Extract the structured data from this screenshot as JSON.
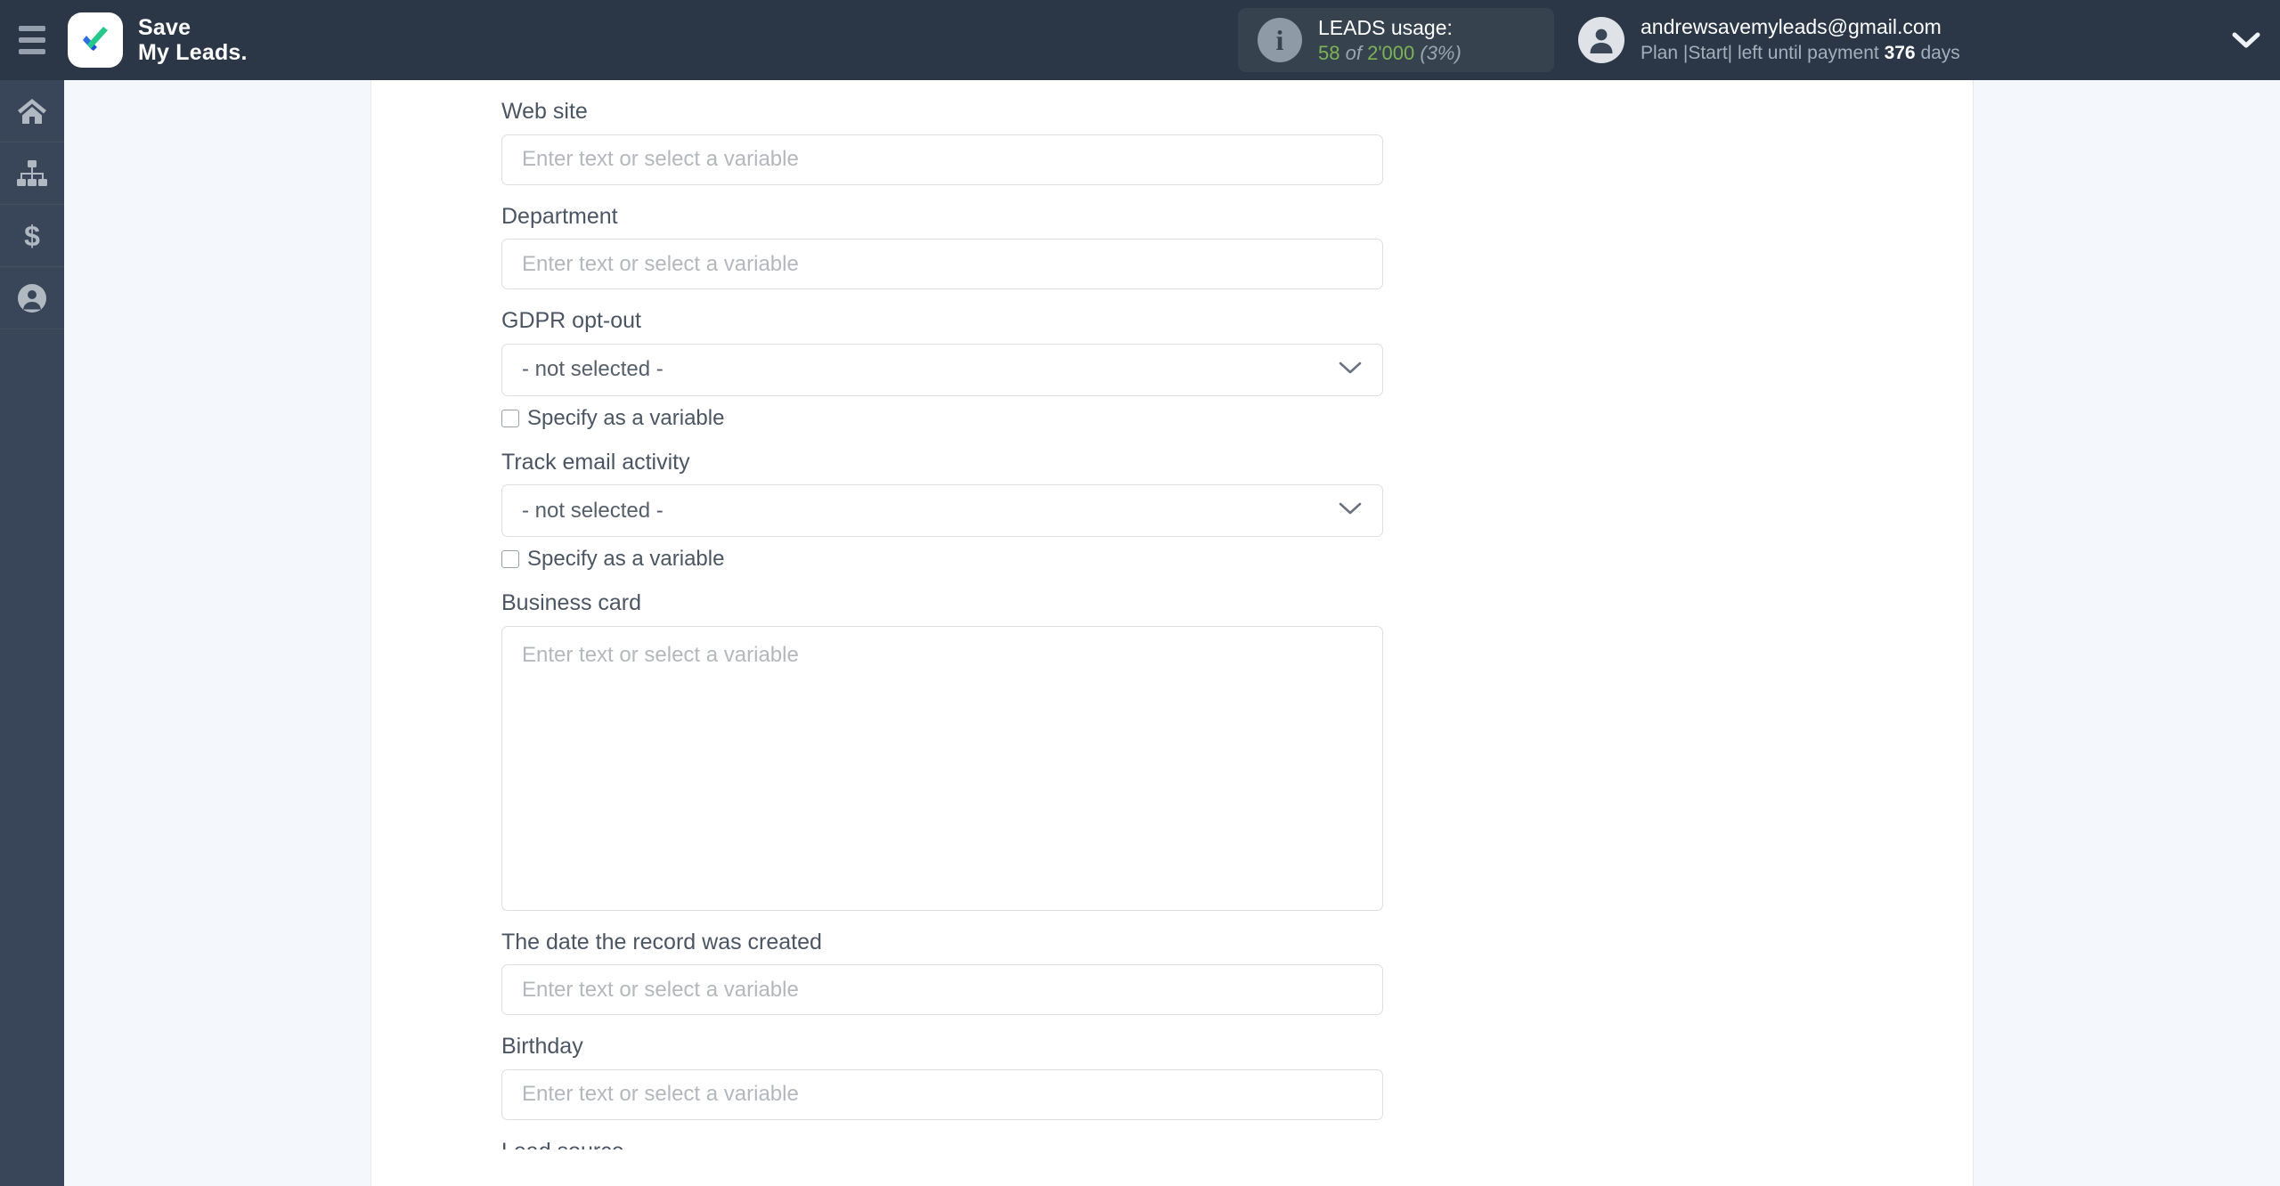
{
  "header": {
    "menu_icon": "hamburger-icon",
    "brand_line1": "Save",
    "brand_line2": "My Leads.",
    "usage": {
      "info_icon": "info-icon",
      "title": "LEADS usage:",
      "used": "58",
      "of": "of",
      "total": "2'000",
      "percent": "(3%)"
    },
    "account": {
      "avatar_icon": "user-avatar-icon",
      "email": "andrewsavemyleads@gmail.com",
      "plan_prefix": "Plan |Start| left until payment",
      "days_value": "376",
      "days_suffix": "days",
      "caret_icon": "chevron-down-icon"
    }
  },
  "sidebar": {
    "items": [
      {
        "name": "home",
        "icon": "home-icon"
      },
      {
        "name": "connections",
        "icon": "sitemap-icon"
      },
      {
        "name": "billing",
        "icon": "dollar-icon"
      },
      {
        "name": "account",
        "icon": "user-circle-icon"
      }
    ]
  },
  "form": {
    "placeholder": "Enter text or select a variable",
    "not_selected": "- not selected -",
    "specify_as_variable": "Specify as a variable",
    "dropdown_icon": "chevron-down-icon",
    "fields": [
      {
        "label": "Web site",
        "type": "text"
      },
      {
        "label": "Department",
        "type": "text"
      },
      {
        "label": "GDPR opt-out",
        "type": "select"
      },
      {
        "label": "Track email activity",
        "type": "select"
      },
      {
        "label": "Business card",
        "type": "textarea"
      },
      {
        "label": "The date the record was created",
        "type": "text"
      },
      {
        "label": "Birthday",
        "type": "text"
      },
      {
        "label": "Lead source",
        "type": "text"
      }
    ]
  },
  "colors": {
    "topbar": "#2b3747",
    "rail": "#39465a",
    "page_bg": "#f4f7fb",
    "panel": "#ffffff",
    "usage_green": "#7db356",
    "brand_green": "#23c88a",
    "brand_blue": "#2f6fe4"
  }
}
